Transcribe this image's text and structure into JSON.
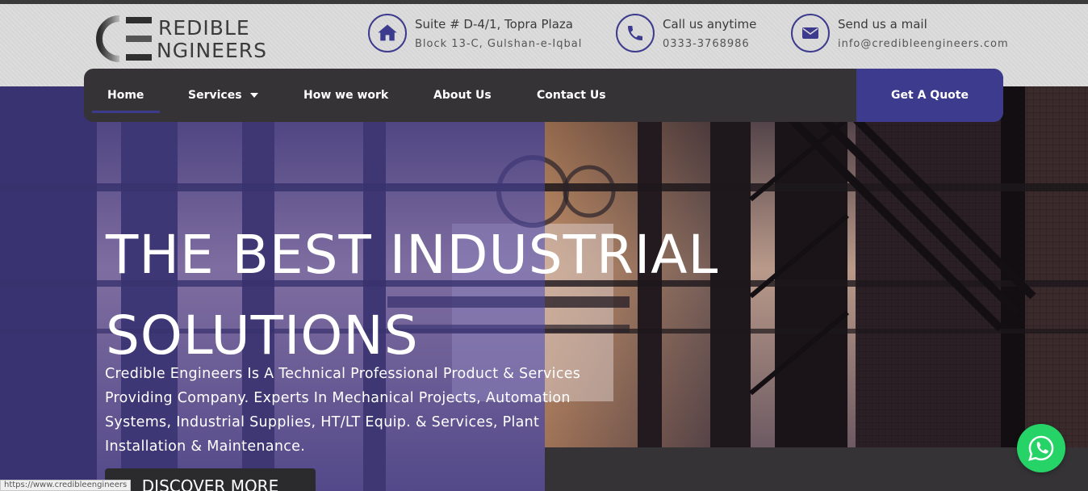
{
  "header": {
    "logo": {
      "line1": "REDIBLE",
      "line2": "NGINEERS"
    },
    "address": {
      "title": "Suite # D-4/1, Topra Plaza",
      "detail": "Block 13-C, Gulshan-e-Iqbal",
      "icon": "home-icon"
    },
    "phone": {
      "title": "Call us anytime",
      "detail": "0333-3768986",
      "icon": "phone-icon"
    },
    "mail": {
      "title": "Send us a mail",
      "detail": "info@credibleengineers.com",
      "icon": "envelope-icon"
    }
  },
  "nav": {
    "items": [
      {
        "label": "Home",
        "active": true
      },
      {
        "label": "Services",
        "dropdown": true
      },
      {
        "label": "How we work"
      },
      {
        "label": "About Us"
      },
      {
        "label": "Contact Us"
      }
    ],
    "cta": "Get A Quote"
  },
  "hero": {
    "title_line1": "THE BEST INDUSTRIAL",
    "title_line2": "SOLUTIONS",
    "description": "Credible Engineers Is A Technical Professional Product & Services Providing Company. Experts In Mechanical Projects, Automation Systems, Industrial Supplies, HT/LT Equip. & Services, Plant Installation & Maintenance.",
    "button": "DISCOVER MORE"
  },
  "status_bar": {
    "url": "https://www.credibleengineers"
  },
  "colors": {
    "accent": "#3d3b8e",
    "nav_bg": "#353336",
    "whatsapp": "#25d366"
  }
}
